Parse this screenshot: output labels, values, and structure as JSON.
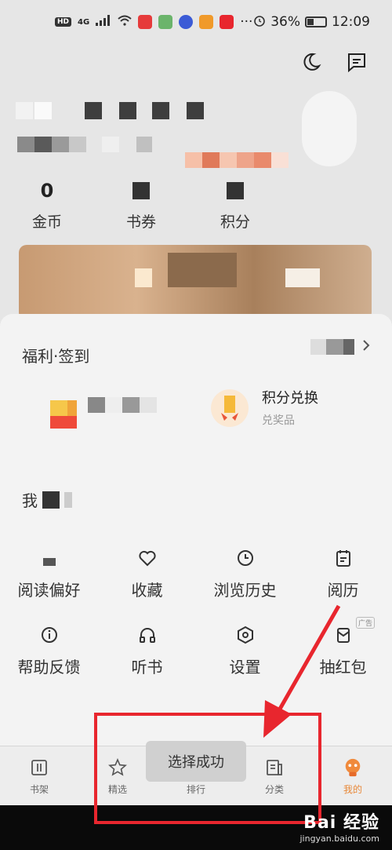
{
  "status_bar": {
    "battery": "36%",
    "time": "12:09",
    "net": "HD",
    "signal": "4G",
    "battery_level": 0.36
  },
  "stats": [
    {
      "value": "0",
      "label": "金币"
    },
    {
      "value": "",
      "label": "书券"
    },
    {
      "value": "",
      "label": "积分"
    }
  ],
  "welfare": {
    "title": "福利·签到",
    "items": [
      {
        "name": "",
        "sub": ""
      },
      {
        "name": "积分兑换",
        "sub": "兑奖品"
      }
    ]
  },
  "services": {
    "title": "我",
    "rows": [
      [
        {
          "label": "阅读偏好",
          "icon": "reading-preference-icon"
        },
        {
          "label": "收藏",
          "icon": "heart-icon"
        },
        {
          "label": "浏览历史",
          "icon": "clock-icon"
        },
        {
          "label": "阅历",
          "icon": "clipboard-icon"
        }
      ],
      [
        {
          "label": "帮助反馈",
          "icon": "info-icon"
        },
        {
          "label": "听书",
          "icon": "headphones-icon"
        },
        {
          "label": "设置",
          "icon": "settings-hex-icon"
        },
        {
          "label": "抽红包",
          "icon": "red-envelope-icon",
          "badge": "广告"
        }
      ]
    ]
  },
  "bottom_nav": [
    {
      "label": "书架",
      "icon": "bookshelf-icon"
    },
    {
      "label": "精选",
      "icon": "star-icon"
    },
    {
      "label": "排行",
      "icon": "rank-icon"
    },
    {
      "label": "分类",
      "icon": "category-icon"
    },
    {
      "label": "我的",
      "icon": "profile-mascot-icon",
      "active": true
    }
  ],
  "toast": "选择成功",
  "watermark": {
    "main": "Bai 经验",
    "sub": "jingyan.baidu.com"
  },
  "colors": {
    "accent": "#e8893a",
    "annotation": "#e8262e"
  }
}
